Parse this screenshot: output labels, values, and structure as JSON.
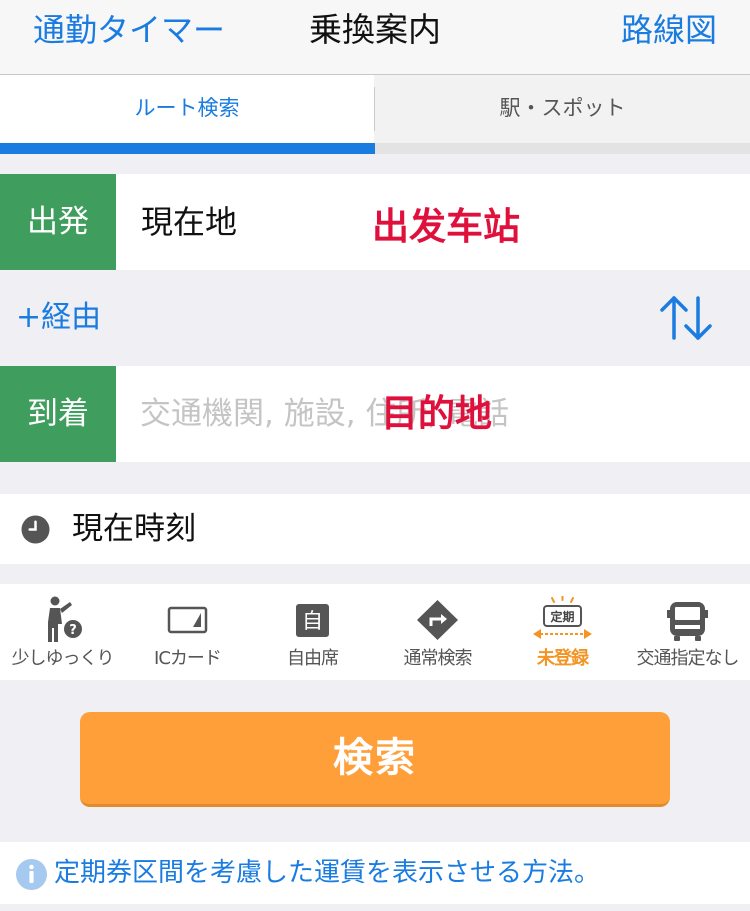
{
  "header": {
    "left_link": "通勤タイマー",
    "title": "乗換案内",
    "right_link": "路線図"
  },
  "tabs": [
    {
      "label": "ルート検索",
      "active": true
    },
    {
      "label": "駅・スポット",
      "active": false
    }
  ],
  "departure": {
    "label": "出発",
    "value": "現在地",
    "overlay": "出发车站"
  },
  "via": {
    "label": "+経由",
    "swap_icon": "swap-arrows-icon"
  },
  "arrival": {
    "label": "到着",
    "placeholder": "交通機関, 施設, 住所, 電話",
    "overlay": "目的地"
  },
  "time": {
    "icon": "clock-icon",
    "value": "現在時刻"
  },
  "options": [
    {
      "label": "少しゆっくり",
      "icon": "walking-person-icon"
    },
    {
      "label": "ICカード",
      "icon": "ic-card-icon"
    },
    {
      "label": "自由席",
      "icon": "seat-icon"
    },
    {
      "label": "通常検索",
      "icon": "route-sign-icon"
    },
    {
      "label": "未登録",
      "icon": "commuter-pass-icon",
      "badge": "定期",
      "highlight": true
    },
    {
      "label": "交通指定なし",
      "icon": "bus-icon"
    }
  ],
  "search_button": "検索",
  "info": {
    "icon": "info-icon",
    "text": "定期券区間を考慮した運賃を表示させる方法。"
  },
  "colors": {
    "accent_blue": "#1a7ce0",
    "label_green": "#3f9e5d",
    "search_orange": "#ff9f3a",
    "overlay_red": "#e0103c",
    "highlight_orange": "#f39524"
  }
}
